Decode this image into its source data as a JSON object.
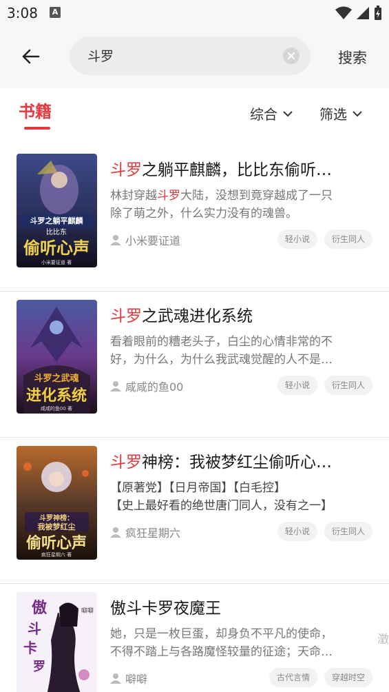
{
  "status": {
    "time": "3:08",
    "notif_icon": "A"
  },
  "header": {
    "search_value": "斗罗",
    "search_button": "搜索"
  },
  "tabs": {
    "books": "书籍",
    "sort": "综合",
    "filter": "筛选"
  },
  "books": [
    {
      "title_highlight": "斗罗",
      "title_rest": "之躺平麒麟，比比东偷听…",
      "desc_line1_pre": "林封穿越",
      "desc_line1_hl": "斗罗",
      "desc_line1_post": "大陆，没想到竟穿越成了一只",
      "desc_line2": "除了萌之外，什么实力没有的魂兽。",
      "author": "小米要证道",
      "tags": [
        "轻小说",
        "衍生同人"
      ],
      "cover_text": "斗罗之躺平麒麟 比比东 偷听心声",
      "cover_colors": [
        "#1c1f3a",
        "#3d4b8a",
        "#e8c64a"
      ]
    },
    {
      "title_highlight": "斗罗",
      "title_rest": "之武魂进化系统",
      "desc_line1": "看着眼前的糟老头子，白尘的心情非常的不",
      "desc_line2": "好，为什么，为什么我武魂觉醒的人不是…",
      "author": "咸咸的鱼00",
      "tags": [
        "轻小说",
        "衍生同人"
      ],
      "cover_text": "斗罗之武魂 进化系统",
      "cover_colors": [
        "#2a1a3e",
        "#6a3a8c",
        "#f0b030"
      ]
    },
    {
      "title_highlight": "斗罗",
      "title_rest": "神榜：我被梦红尘偷听心…",
      "desc_line1": "【原著党】【日月帝国】【白毛控】",
      "desc_line2": "【史上最好看的绝世唐门同人，没有之一】",
      "author": "疯狂星期六",
      "tags": [
        "轻小说",
        "衍生同人"
      ],
      "cover_text": "斗罗神榜 我被梦红尘 偷听心声",
      "cover_colors": [
        "#3a2a1a",
        "#b86a2a",
        "#f2d27a"
      ]
    },
    {
      "title_highlight": "",
      "title_rest": "傲斗卡罗夜魔王",
      "desc_line1": "她，只是一枚巨蛋，却身负不平凡的使命，",
      "desc_line2": "不得不踏上与各路魔怪较量的征途；天命…",
      "author": "噼噼",
      "tags": [
        "古代言情",
        "穿越时空"
      ],
      "edge_text": "澂转",
      "cover_text": "傲斗卡罗夜魔王",
      "cover_colors": [
        "#f4eef6",
        "#6a2a7a",
        "#2a1a2e"
      ]
    }
  ]
}
